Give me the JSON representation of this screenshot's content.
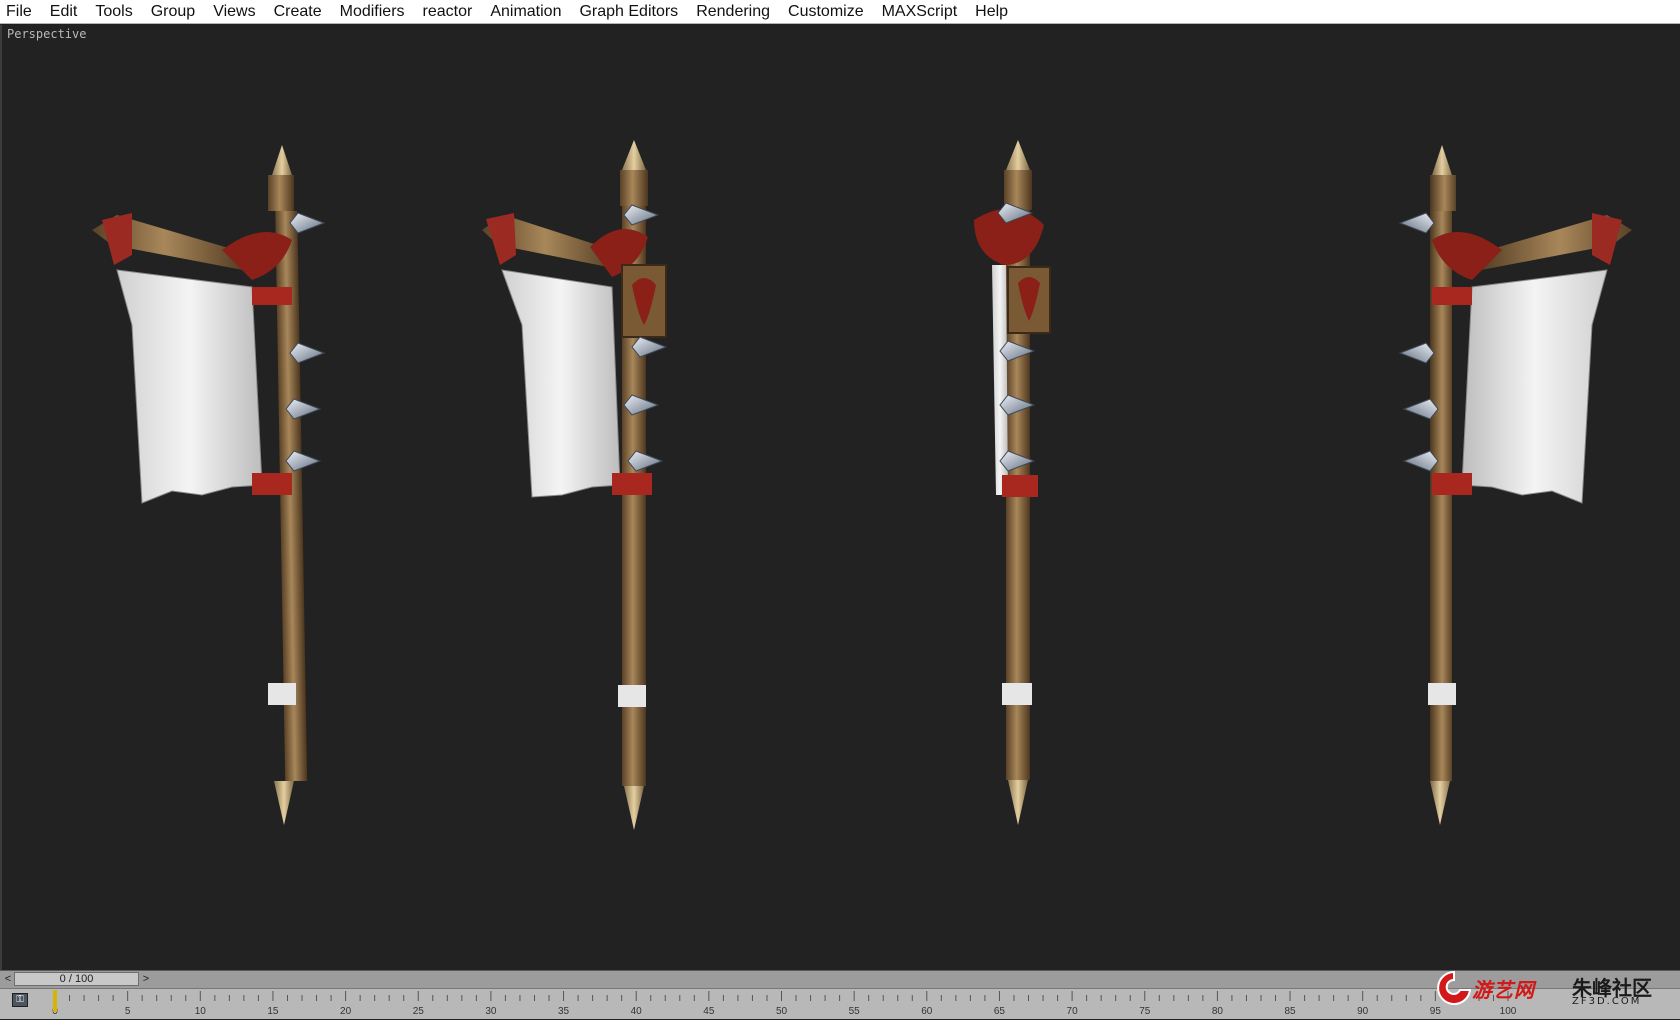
{
  "menu": {
    "items": [
      "File",
      "Edit",
      "Tools",
      "Group",
      "Views",
      "Create",
      "Modifiers",
      "reactor",
      "Animation",
      "Graph Editors",
      "Rendering",
      "Customize",
      "MAXScript",
      "Help"
    ]
  },
  "viewport": {
    "label": "Perspective",
    "background": "#222222",
    "objects": [
      "banner-pole-view-1",
      "banner-pole-view-2",
      "banner-pole-view-3",
      "banner-pole-view-4"
    ]
  },
  "time_slider": {
    "left_arrow": "<",
    "frame_display": "0 / 100",
    "right_arrow": ">"
  },
  "trackbar": {
    "key_icon": "key-filter-icon",
    "tick_labels": [
      "0",
      "5",
      "10",
      "15",
      "20",
      "25",
      "30",
      "35",
      "40",
      "45",
      "50",
      "55",
      "60",
      "65",
      "70",
      "75",
      "80",
      "85",
      "90",
      "95",
      "100"
    ]
  },
  "watermark": {
    "site_name": "游艺网",
    "community": "朱峰社区",
    "domain": "ZF3D.COM",
    "accent_color": "#d21818"
  }
}
